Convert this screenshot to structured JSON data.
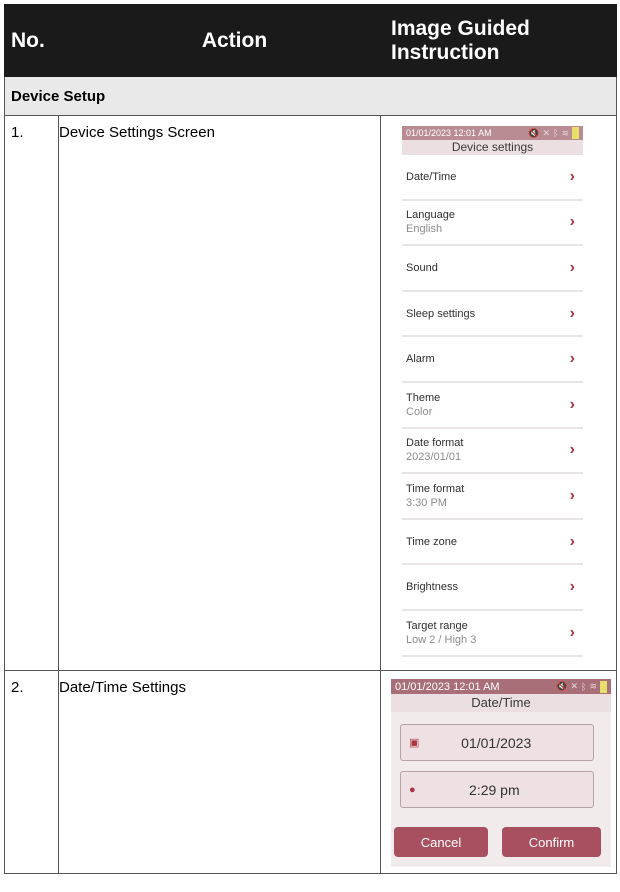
{
  "header": {
    "no": "No.",
    "action": "Action",
    "image": "Image Guided Instruction"
  },
  "section": "Device Setup",
  "steps": [
    {
      "no": "1.",
      "action": "Device Settings Screen"
    },
    {
      "no": "2.",
      "action": "Date/Time Settings"
    }
  ],
  "screen1": {
    "status_time": "01/01/2023 12:01 AM",
    "title": "Device settings",
    "items": [
      {
        "label": "Date/Time",
        "sub": ""
      },
      {
        "label": "Language",
        "sub": "English"
      },
      {
        "label": "Sound",
        "sub": ""
      },
      {
        "label": "Sleep settings",
        "sub": ""
      },
      {
        "label": "Alarm",
        "sub": ""
      },
      {
        "label": "Theme",
        "sub": "Color"
      },
      {
        "label": "Date format",
        "sub": "2023/01/01"
      },
      {
        "label": "Time format",
        "sub": "3:30 PM"
      },
      {
        "label": "Time zone",
        "sub": ""
      },
      {
        "label": "Brightness",
        "sub": ""
      },
      {
        "label": "Target range",
        "sub": "Low 2 / High 3"
      }
    ]
  },
  "screen2": {
    "status_time": "01/01/2023 12:01 AM",
    "title": "Date/Time",
    "date": "01/01/2023",
    "time": "2:29 pm",
    "cancel": "Cancel",
    "confirm": "Confirm"
  }
}
